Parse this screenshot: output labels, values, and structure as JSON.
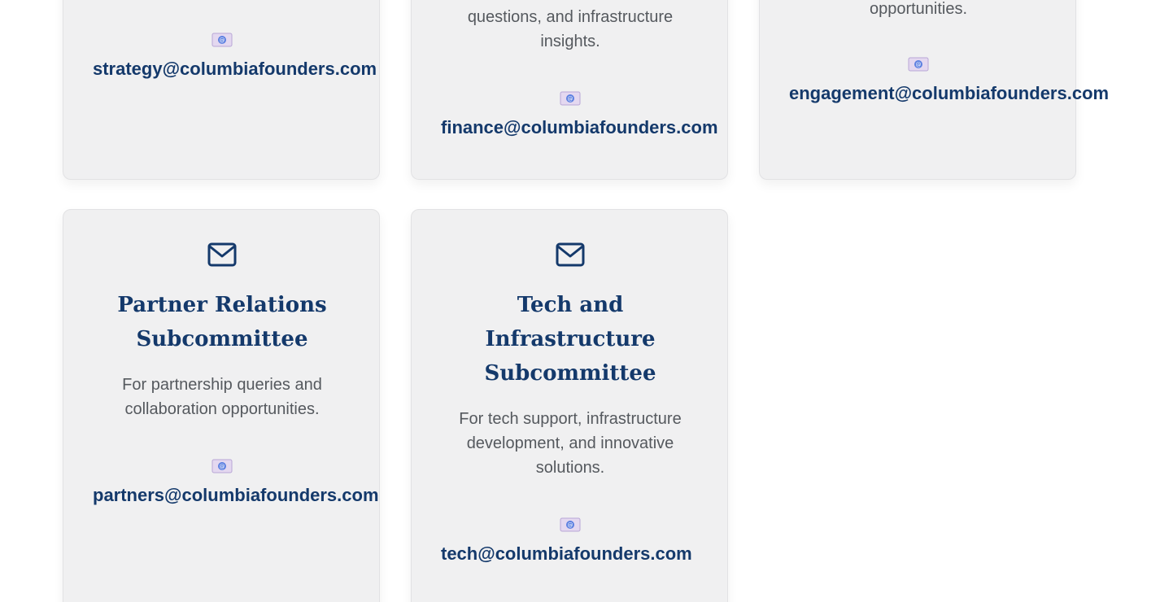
{
  "cards": [
    {
      "id": "strategy",
      "email": "strategy@columbiafounders.com"
    },
    {
      "id": "finance",
      "description_lines": [
        "questions, and infrastructure",
        "insights."
      ],
      "email": "finance@columbiafounders.com"
    },
    {
      "id": "engagement",
      "description_lines": [
        "opportunities."
      ],
      "email": "engagement@columbiafounders.com"
    },
    {
      "id": "partners",
      "icon": "mail-icon",
      "title_lines": [
        "Partner Relations",
        "Subcommittee"
      ],
      "description_lines": [
        "For partnership queries and",
        "collaboration opportunities."
      ],
      "email_icon": "e-mail-emoji-icon",
      "email": "partners@columbiafounders.com"
    },
    {
      "id": "tech",
      "icon": "mail-icon",
      "title_lines": [
        "Tech and",
        "Infrastructure",
        "Subcommittee"
      ],
      "description_lines": [
        "For tech support, infrastructure",
        "development, and innovative",
        "solutions."
      ],
      "email_icon": "e-mail-emoji-icon",
      "email": "tech@columbiafounders.com"
    }
  ],
  "colors": {
    "card_background": "#f0f0f1",
    "accent_navy": "#14396b",
    "body_text": "#55595e"
  }
}
